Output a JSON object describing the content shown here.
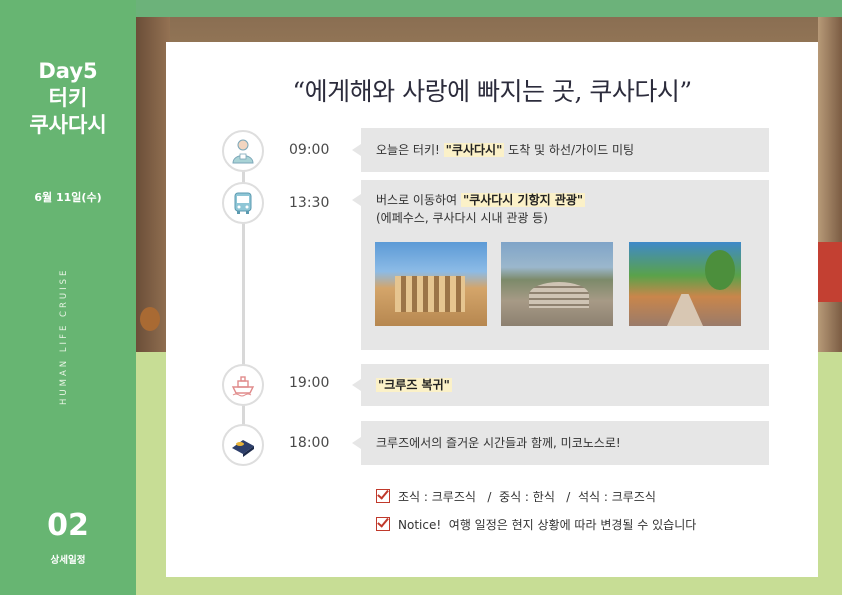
{
  "sidebar": {
    "title_line1": "Day5",
    "title_line2": "터키",
    "title_line3": "쿠사다시",
    "date": "6월 11일(수)",
    "vertical_text": "HUMAN LIFE CRUISE",
    "section_number": "02",
    "section_label": "상세일정"
  },
  "headline": "“에게해와 사랑에 빠지는 곳, 쿠사다시”",
  "schedule": [
    {
      "time": "09:00",
      "icon": "guide-person-icon",
      "text_before": "오늘은 터키!",
      "highlight": "\"쿠사다시\"",
      "text_after": "도착 및 하선/가이드 미팅"
    },
    {
      "time": "13:30",
      "icon": "bus-icon",
      "text_before": "버스로 이동하여",
      "highlight": "\"쿠사다시 기항지 관광\"",
      "subtext": "(에페수스, 쿠사다시 시내 관광 등)",
      "photos": [
        "ephesus-library-photo",
        "ancient-theatre-photo",
        "kusadasi-street-photo"
      ]
    },
    {
      "time": "19:00",
      "icon": "cruise-ship-icon",
      "highlight": "\"크루즈 복귀\""
    },
    {
      "time": "18:00",
      "icon": "bed-icon",
      "text": "크루즈에서의 즐거운 시간들과 함께, 미코노스로!"
    }
  ],
  "notes": [
    "조식 : 크루즈식   /  중식 : 한식   /  석식 : 크루즈식",
    "Notice!  여행 일정은 현지 상황에 따라 변경될 수 있습니다"
  ],
  "colors": {
    "sidebar": "#67b572",
    "accent_check": "#c0392b",
    "highlight": "#fbf1c8",
    "box": "#e6e6e6"
  }
}
